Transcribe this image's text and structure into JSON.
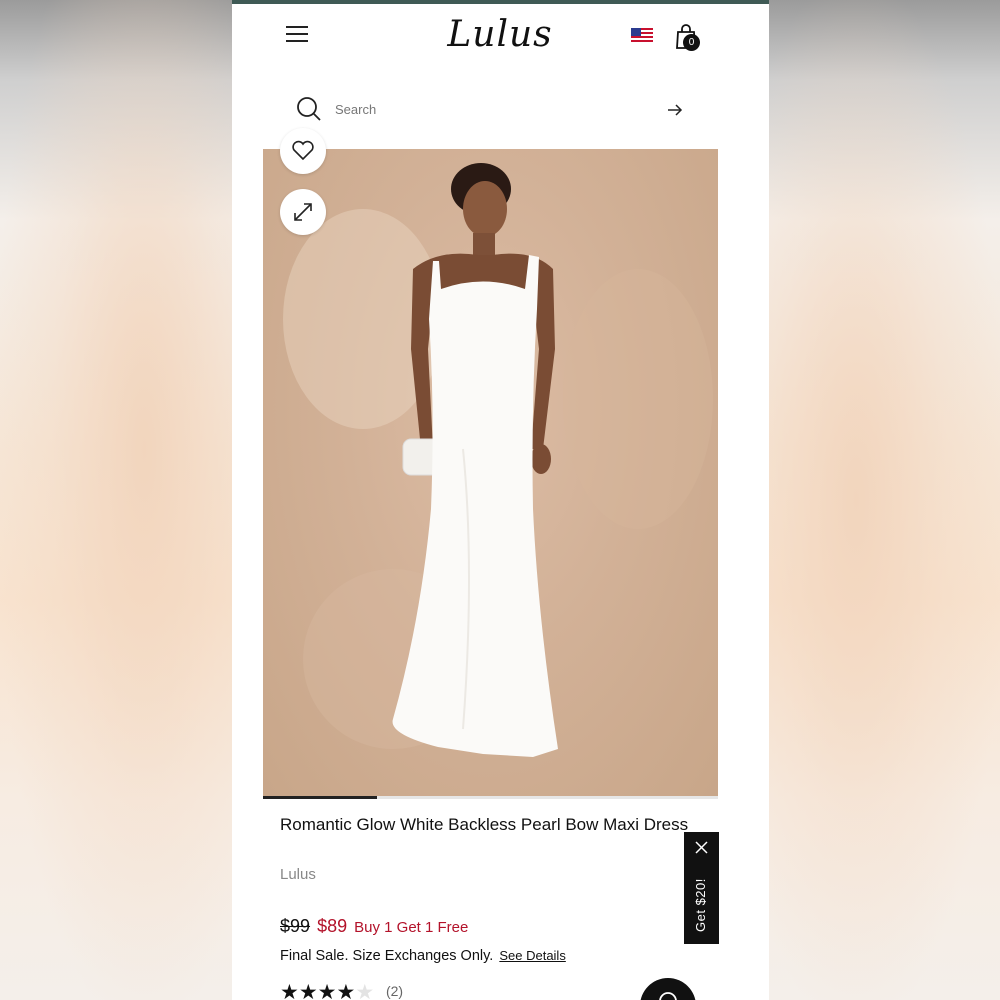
{
  "header": {
    "logo_text": "Lulus",
    "cart_count": "0",
    "icons": [
      "menu-icon",
      "us-flag-icon",
      "shopping-bag-icon"
    ]
  },
  "search": {
    "placeholder": "Search",
    "icons": [
      "search-icon",
      "arrow-right-icon"
    ]
  },
  "gallery": {
    "icons": [
      "heart-icon",
      "expand-icon"
    ],
    "progress_fraction": 0.25,
    "image_description_colors": {
      "backdrop": "#d2b197",
      "dress": "#fafafa"
    }
  },
  "product": {
    "title": "Romantic Glow White Backless Pearl Bow Maxi Dress",
    "brand": "Lulus",
    "old_price": "$99",
    "new_price": "$89",
    "promo": "Buy 1 Get 1 Free",
    "final_sale": "Final Sale. Size Exchanges Only.",
    "see_details": "See Details",
    "rating_stars": 4,
    "rating_max": 5,
    "review_count": "(2)"
  },
  "promo_tab": {
    "label": "Get $20!",
    "icons": [
      "close-icon"
    ]
  },
  "chat": {
    "icons": [
      "chat-icon"
    ]
  },
  "colors": {
    "accent_red": "#b3122a",
    "text": "#111111",
    "muted": "#888888",
    "top_bar": "#3f5a55"
  }
}
